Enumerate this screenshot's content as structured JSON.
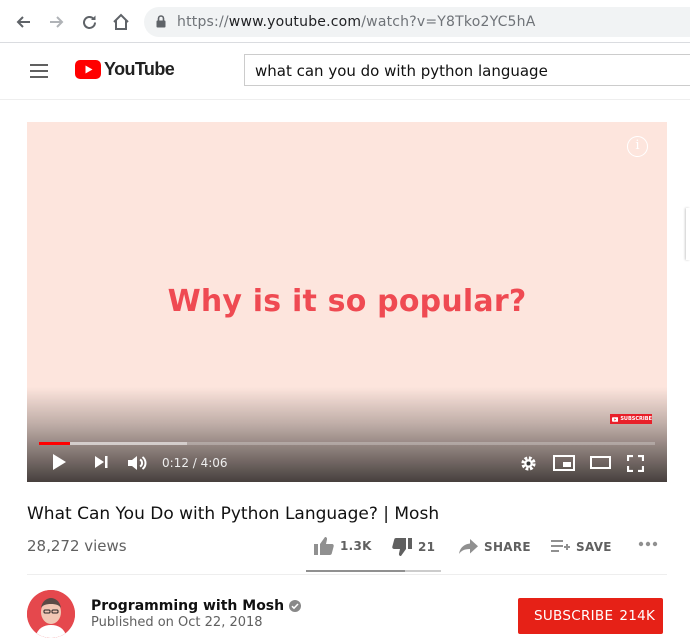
{
  "browser": {
    "url_scheme": "https://",
    "url_host": "www.youtube.com",
    "url_path": "/watch?v=Y8Tko2YC5hA"
  },
  "masthead": {
    "logo_text": "YouTube",
    "search_query": "what can you do with python language"
  },
  "player": {
    "slide_text": "Why is it so popular?",
    "watermark_text": "SUBSCRIBE",
    "time_display": "0:12 / 4:06",
    "played_fraction": 0.05,
    "buffered_fraction": 0.24
  },
  "video": {
    "title": "What Can You Do with Python Language? | Mosh",
    "views": "28,272 views",
    "likes": "1.3K",
    "dislikes": "21",
    "share_label": "SHARE",
    "save_label": "SAVE",
    "like_fraction": 0.73
  },
  "channel": {
    "name": "Programming with Mosh",
    "published": "Published on Oct 22, 2018",
    "subscribe_label": "SUBSCRIBE",
    "subscriber_count": "214K"
  },
  "colors": {
    "brand_red": "#ff0000",
    "subscribe_red": "#e62117",
    "slide_background": "#fde5dd",
    "slide_text": "#ef4a52"
  }
}
